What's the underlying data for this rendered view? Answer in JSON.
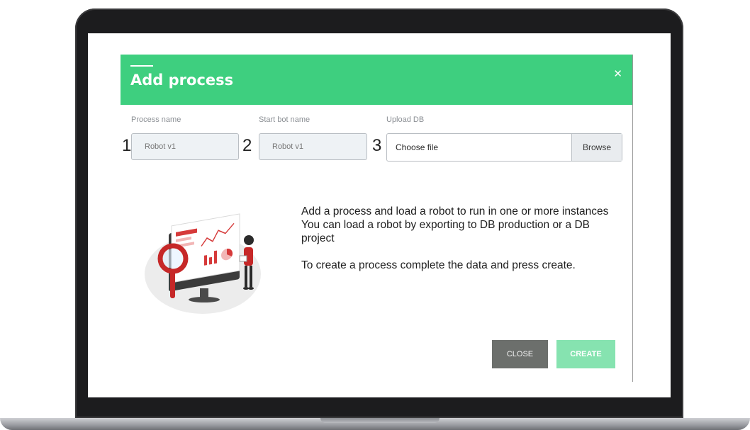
{
  "modal": {
    "title": "Add process",
    "close_icon": "close-icon"
  },
  "fields": [
    {
      "number": "1",
      "label": "Process name",
      "placeholder": "Robot v1"
    },
    {
      "number": "2",
      "label": "Start bot name",
      "placeholder": "Robot v1"
    },
    {
      "number": "3",
      "label": "Upload DB",
      "file_text": "Choose file",
      "browse_label": "Browse"
    }
  ],
  "info": {
    "paragraph1": "Add a process and load a robot to run in one or more instances You can load a robot by exporting to DB production or a DB project",
    "paragraph2": "To create a process complete the data and press create."
  },
  "buttons": {
    "close_label": "CLOSE",
    "create_label": "CREATE"
  },
  "colors": {
    "header": "#3ecf7f",
    "create": "#86e3b0",
    "close": "#6c6f6c"
  }
}
